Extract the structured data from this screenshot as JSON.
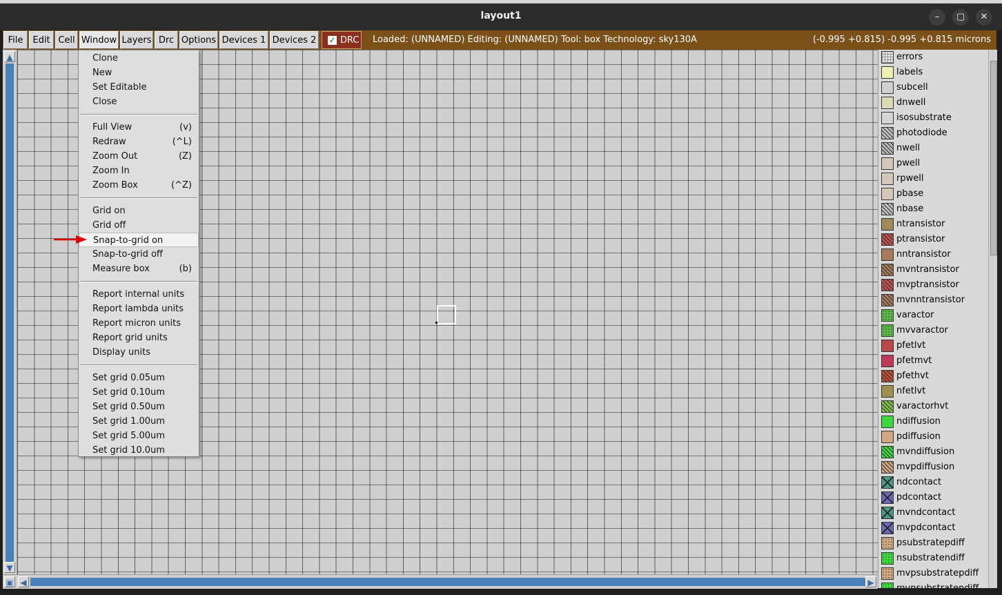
{
  "window": {
    "title": "layout1"
  },
  "window_controls": {
    "minimize": "–",
    "maximize": "▢",
    "close": "✕"
  },
  "menubar": {
    "items": [
      "File",
      "Edit",
      "Cell",
      "Window",
      "Layers",
      "Drc",
      "Options",
      "Devices 1",
      "Devices 2"
    ],
    "drc_toggle": {
      "label": "DRC",
      "checked": true
    },
    "status": "Loaded: (UNNAMED) Editing: (UNNAMED) Tool: box  Technology: sky130A",
    "coords": "(-0.995 +0.815) -0.995 +0.815 microns"
  },
  "window_menu": {
    "groups": [
      [
        {
          "label": "Clone",
          "shortcut": ""
        },
        {
          "label": "New",
          "shortcut": ""
        },
        {
          "label": "Set Editable",
          "shortcut": ""
        },
        {
          "label": "Close",
          "shortcut": ""
        }
      ],
      [
        {
          "label": "Full View",
          "shortcut": "(v)"
        },
        {
          "label": "Redraw",
          "shortcut": "(^L)"
        },
        {
          "label": "Zoom Out",
          "shortcut": "(Z)"
        },
        {
          "label": "Zoom In",
          "shortcut": ""
        },
        {
          "label": "Zoom Box",
          "shortcut": "(^Z)"
        }
      ],
      [
        {
          "label": "Grid on",
          "shortcut": ""
        },
        {
          "label": "Grid off",
          "shortcut": ""
        },
        {
          "label": "Snap-to-grid on",
          "shortcut": "",
          "highlighted": true
        },
        {
          "label": "Snap-to-grid off",
          "shortcut": ""
        },
        {
          "label": "Measure box",
          "shortcut": "(b)"
        }
      ],
      [
        {
          "label": "Report internal units",
          "shortcut": ""
        },
        {
          "label": "Report lambda units",
          "shortcut": ""
        },
        {
          "label": "Report micron units",
          "shortcut": ""
        },
        {
          "label": "Report grid units",
          "shortcut": ""
        },
        {
          "label": "Display units",
          "shortcut": ""
        }
      ],
      [
        {
          "label": "Set grid 0.05um",
          "shortcut": ""
        },
        {
          "label": "Set grid 0.10um",
          "shortcut": ""
        },
        {
          "label": "Set grid 0.50um",
          "shortcut": ""
        },
        {
          "label": "Set grid 1.00um",
          "shortcut": ""
        },
        {
          "label": "Set grid 5.00um",
          "shortcut": ""
        },
        {
          "label": "Set grid 10.0um",
          "shortcut": ""
        }
      ]
    ]
  },
  "annotation": {
    "arrow_color": "#e00000"
  },
  "layers": [
    {
      "name": "errors",
      "color": "#e6e6e6",
      "pattern": "grid"
    },
    {
      "name": "labels",
      "color": "#f0f0b0",
      "pattern": "solid"
    },
    {
      "name": "subcell",
      "color": "#d0d0d0",
      "pattern": "solid"
    },
    {
      "name": "dnwell",
      "color": "#dcdcb4",
      "pattern": "solid"
    },
    {
      "name": "isosubstrate",
      "color": "#d4d4d4",
      "pattern": "solid"
    },
    {
      "name": "photodiode",
      "color": "#c0c0c0",
      "pattern": "hatch"
    },
    {
      "name": "nwell",
      "color": "#b8b8b8",
      "pattern": "hatch"
    },
    {
      "name": "pwell",
      "color": "#d6c8b8",
      "pattern": "solid"
    },
    {
      "name": "rpwell",
      "color": "#d6c8b8",
      "pattern": "solid"
    },
    {
      "name": "pbase",
      "color": "#d6c8b8",
      "pattern": "solid"
    },
    {
      "name": "nbase",
      "color": "#c0c0c0",
      "pattern": "hatch"
    },
    {
      "name": "ntransistor",
      "color": "#a08a5a",
      "pattern": "solid"
    },
    {
      "name": "ptransistor",
      "color": "#c0504d",
      "pattern": "hatch"
    },
    {
      "name": "nntransistor",
      "color": "#a87a5a",
      "pattern": "solid"
    },
    {
      "name": "mvntransistor",
      "color": "#a87a5a",
      "pattern": "hatch"
    },
    {
      "name": "mvptransistor",
      "color": "#c0504d",
      "pattern": "hatch"
    },
    {
      "name": "mvnntransistor",
      "color": "#a87a5a",
      "pattern": "hatch"
    },
    {
      "name": "varactor",
      "color": "#5cb848",
      "pattern": "dots"
    },
    {
      "name": "mvvaractor",
      "color": "#5cb848",
      "pattern": "dots"
    },
    {
      "name": "pfetlvt",
      "color": "#b84848",
      "pattern": "solid"
    },
    {
      "name": "pfetmvt",
      "color": "#c03858",
      "pattern": "solid"
    },
    {
      "name": "pfethvt",
      "color": "#c05030",
      "pattern": "hatch"
    },
    {
      "name": "nfetlvt",
      "color": "#a09050",
      "pattern": "solid"
    },
    {
      "name": "varactorhvt",
      "color": "#80c040",
      "pattern": "hatch"
    },
    {
      "name": "ndiffusion",
      "color": "#3ed83e",
      "pattern": "solid"
    },
    {
      "name": "pdiffusion",
      "color": "#d0a880",
      "pattern": "solid"
    },
    {
      "name": "mvndiffusion",
      "color": "#3ed83e",
      "pattern": "hatch"
    },
    {
      "name": "mvpdiffusion",
      "color": "#d0a880",
      "pattern": "hatch"
    },
    {
      "name": "ndcontact",
      "color": "#4a9a8a",
      "pattern": "cross"
    },
    {
      "name": "pdcontact",
      "color": "#6a6ab8",
      "pattern": "cross"
    },
    {
      "name": "mvndcontact",
      "color": "#4a9a8a",
      "pattern": "cross"
    },
    {
      "name": "mvpdcontact",
      "color": "#6a6ab8",
      "pattern": "cross"
    },
    {
      "name": "psubstratepdiff",
      "color": "#d0a880",
      "pattern": "dots"
    },
    {
      "name": "nsubstratendiff",
      "color": "#3ed83e",
      "pattern": "dots"
    },
    {
      "name": "mvpsubstratepdiff",
      "color": "#d0a880",
      "pattern": "dots"
    },
    {
      "name": "mvnsubstratendiff",
      "color": "#3ed83e",
      "pattern": "dots"
    }
  ]
}
